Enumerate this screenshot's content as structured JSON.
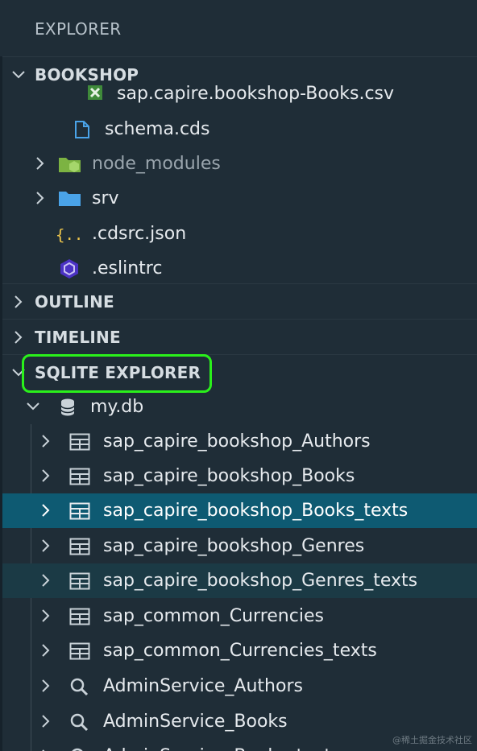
{
  "explorer": {
    "title": "EXPLORER"
  },
  "bookshop": {
    "header": "BOOKSHOP",
    "items": [
      {
        "label": "sap.capire.bookshop-Books.csv",
        "icon": "csv-file-icon"
      },
      {
        "label": "schema.cds",
        "icon": "file-icon"
      },
      {
        "label": "node_modules",
        "icon": "node-folder-icon"
      },
      {
        "label": "srv",
        "icon": "folder-icon"
      },
      {
        "label": ".cdsrc.json",
        "icon": "json-braces-icon"
      },
      {
        "label": ".eslintrc",
        "icon": "eslint-icon"
      }
    ]
  },
  "sections": {
    "outline": "OUTLINE",
    "timeline": "TIMELINE",
    "sqlite_explorer": "SQLITE EXPLORER"
  },
  "database": {
    "name": "my.db",
    "tables": [
      {
        "label": "sap_capire_bookshop_Authors",
        "icon": "table-icon"
      },
      {
        "label": "sap_capire_bookshop_Books",
        "icon": "table-icon"
      },
      {
        "label": "sap_capire_bookshop_Books_texts",
        "icon": "table-icon",
        "state": "selected"
      },
      {
        "label": "sap_capire_bookshop_Genres",
        "icon": "table-icon"
      },
      {
        "label": "sap_capire_bookshop_Genres_texts",
        "icon": "table-icon",
        "state": "hovered"
      },
      {
        "label": "sap_common_Currencies",
        "icon": "table-icon"
      },
      {
        "label": "sap_common_Currencies_texts",
        "icon": "table-icon"
      },
      {
        "label": "AdminService_Authors",
        "icon": "search-icon"
      },
      {
        "label": "AdminService_Books",
        "icon": "search-icon"
      },
      {
        "label": "AdminService_Books_texts",
        "icon": "search-icon"
      }
    ]
  },
  "colors": {
    "background": "#1f2d37",
    "selected": "#0e5a72",
    "highlight": "#2af01b",
    "folder": "#4aa3e8",
    "node_folder": "#8bc34a"
  },
  "watermark": "@稀土掘金技术社区"
}
